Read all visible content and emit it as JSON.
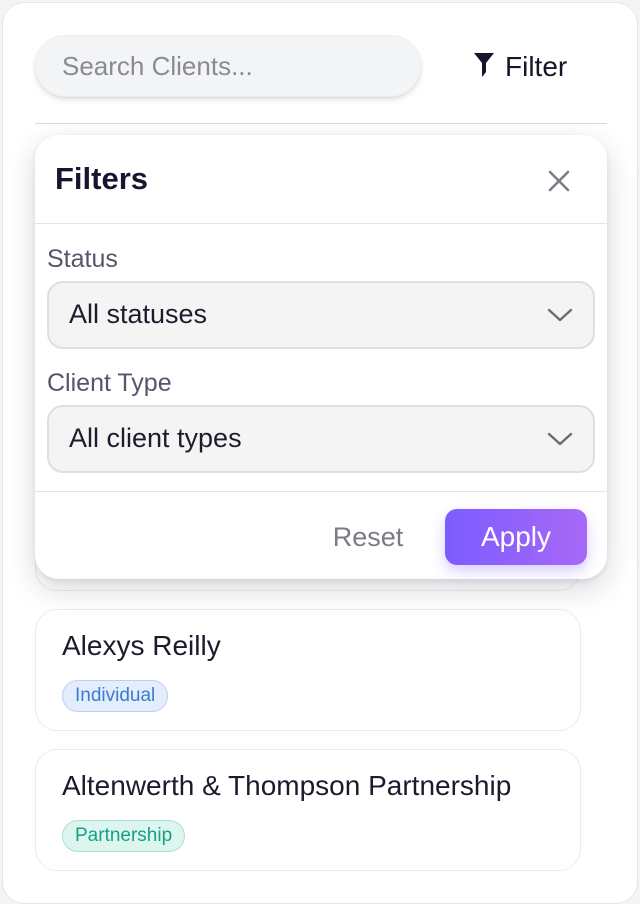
{
  "search": {
    "placeholder": "Search Clients..."
  },
  "toolbar": {
    "filter_label": "Filter",
    "filter_icon": "funnel-icon"
  },
  "filters_popover": {
    "title": "Filters",
    "close_icon": "close-icon",
    "status": {
      "label": "Status",
      "selected": "All statuses"
    },
    "client_type": {
      "label": "Client Type",
      "selected": "All client types"
    },
    "reset_label": "Reset",
    "apply_label": "Apply"
  },
  "clients": [
    {
      "name": "Alexys Reilly",
      "type": "Individual"
    },
    {
      "name": "Altenwerth & Thompson Partnership",
      "type": "Partnership"
    }
  ],
  "colors": {
    "accent_start": "#7c5cff",
    "accent_end": "#a868f7",
    "individual_badge_bg": "#e3edfb",
    "individual_badge_text": "#3a7bd5",
    "partnership_badge_bg": "#dcf5ee",
    "partnership_badge_text": "#16a085"
  }
}
